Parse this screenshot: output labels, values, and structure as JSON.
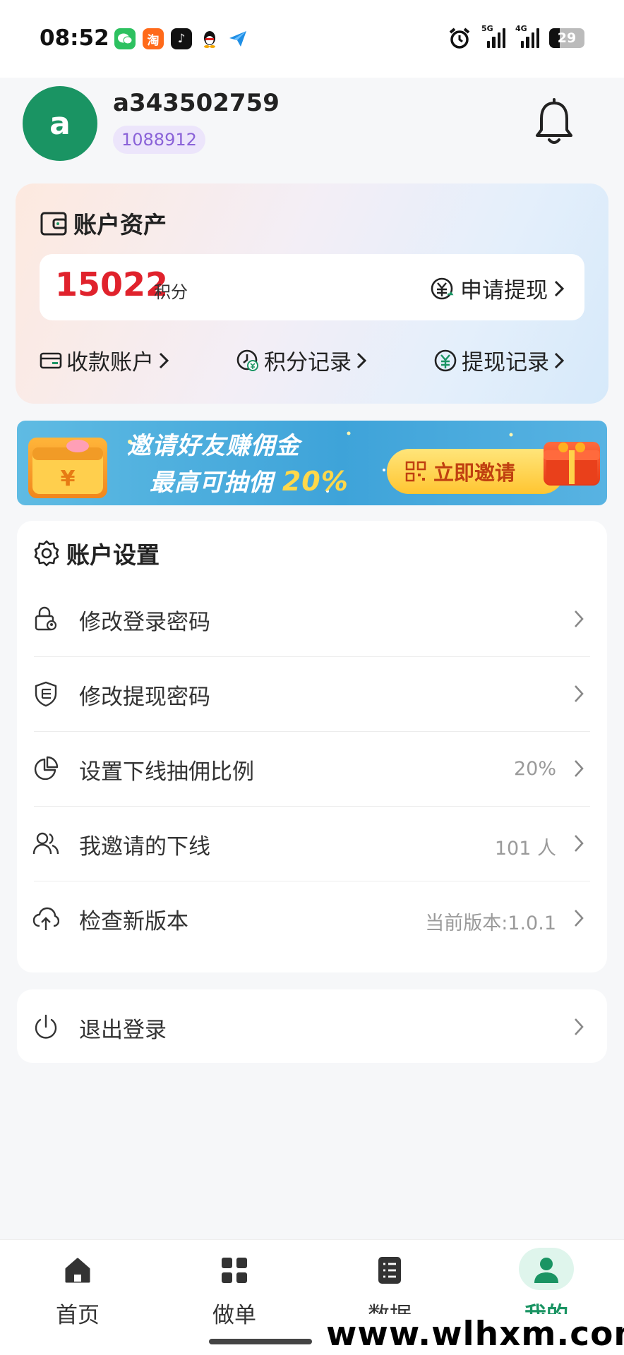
{
  "status_bar": {
    "time": "08:52",
    "apps": [
      {
        "icon": "wechat-icon",
        "glyph": "",
        "color": "#2dc160"
      },
      {
        "icon": "taobao-icon",
        "glyph": "淘",
        "color": "#ff6a1a"
      },
      {
        "icon": "tiktok-icon",
        "glyph": "♪",
        "color": "#111111"
      },
      {
        "icon": "qq-icon",
        "glyph": "",
        "color": "#ffffff"
      },
      {
        "icon": "send-icon",
        "glyph": "",
        "color": "#ffffff"
      }
    ],
    "signal_5g_label": "5G",
    "signal_4g_label": "4G",
    "battery": "29",
    "battery_level": 0.29
  },
  "profile": {
    "avatar_letter": "a",
    "username": "a343502759",
    "user_id": "1088912"
  },
  "assets": {
    "title": "账户资产",
    "balance": "15022",
    "balance_unit": "积分",
    "withdraw_label": "申请提现",
    "links": [
      {
        "label": "收款账户"
      },
      {
        "label": "积分记录"
      },
      {
        "label": "提现记录"
      }
    ]
  },
  "banner": {
    "line1": "邀请好友赚佣金",
    "line2_prefix": "最高可抽佣",
    "line2_pct": "20%",
    "button_label": "立即邀请"
  },
  "settings": {
    "title": "账户设置",
    "rows": [
      {
        "label": "修改登录密码",
        "value": ""
      },
      {
        "label": "修改提现密码",
        "value": ""
      },
      {
        "label": "设置下线抽佣比例",
        "value": "20%"
      },
      {
        "label": "我邀请的下线",
        "value": "101 人"
      },
      {
        "label": "检查新版本",
        "value": "当前版本:1.0.1"
      }
    ]
  },
  "logout": {
    "label": "退出登录"
  },
  "bottom_nav": {
    "items": [
      {
        "label": "首页"
      },
      {
        "label": "做单"
      },
      {
        "label": "数据"
      },
      {
        "label": "我的"
      }
    ],
    "active_color": "#1a9463"
  },
  "watermark": "www.wlhxm.com"
}
